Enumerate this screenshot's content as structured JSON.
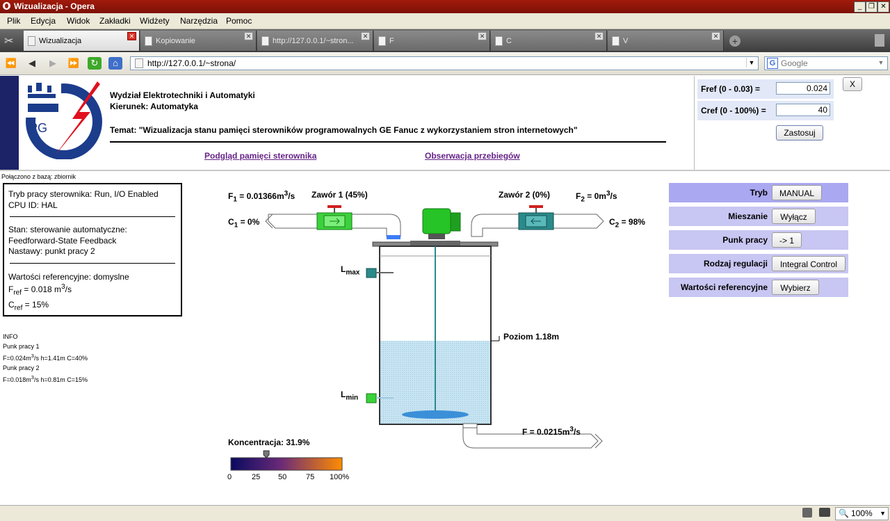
{
  "window": {
    "title": "Wizualizacja - Opera"
  },
  "menu": [
    "Plik",
    "Edycja",
    "Widok",
    "Zakładki",
    "Widżety",
    "Narzędzia",
    "Pomoc"
  ],
  "tabs": [
    {
      "label": "Wizualizacja"
    },
    {
      "label": "Kopiowanie"
    },
    {
      "label": "http://127.0.0.1/~stron..."
    },
    {
      "label": "F"
    },
    {
      "label": "C"
    },
    {
      "label": "V"
    }
  ],
  "address": {
    "url": "http://127.0.0.1/~strona/",
    "search_placeholder": "Google"
  },
  "header": {
    "line1": "Wydział Elektrotechniki i Automatyki",
    "line2": "Kierunek: Automatyka",
    "topic": "Temat: \"Wizualizacja stanu pamięci sterowników programowalnych GE Fanuc z wykorzystaniem stron internetowych\"",
    "link1": "Podgląd pamięci sterownika",
    "link2": "Obserwacja przebiegów",
    "logo_text": "PG"
  },
  "refs": {
    "fref_label": "Fref (0 - 0.03) =",
    "fref_value": "0.024",
    "cref_label": "Cref (0 - 100%) =",
    "cref_value": "40",
    "apply_label": "Zastosuj",
    "close_label": "X"
  },
  "connected": "Połączono z bazą: zbiornik",
  "status": {
    "mode": "Tryb pracy sterownika: Run, I/O Enabled",
    "cpu": "CPU ID: HAL",
    "state": "Stan: sterowanie automatyczne:",
    "ff": "Feedforward-State Feedback",
    "settings": "Nastawy: punkt pracy 2",
    "refvals": "Wartości referencyjne: domyslne",
    "fref_text": "F",
    "fref_sub": "ref",
    "fref_val": " = 0.018 m",
    "fref_unit_sup": "3",
    "fref_unit_tail": "/s",
    "cref_text": "C",
    "cref_sub": "ref",
    "cref_val": " = 15%"
  },
  "info": {
    "title": "INFO",
    "p1_title": "Punk pracy 1",
    "p1_a": "F=0.024m",
    "p1_sup": "3",
    "p1_b": "/s h=1.41m C=40%",
    "p2_title": "Punk pracy 2",
    "p2_a": "F=0.018m",
    "p2_sup": "3",
    "p2_b": "/s h=0.81m C=15%"
  },
  "process": {
    "f1_a": "F",
    "f1_sub": "1",
    "f1_b": " = 0.01366m",
    "f1_sup": "3",
    "f1_c": "/s",
    "valve1": "Zawór 1 (45%)",
    "valve2": "Zawór 2 (0%)",
    "f2_a": "F",
    "f2_sub": "2",
    "f2_b": " = 0m",
    "f2_sup": "3",
    "f2_c": "/s",
    "c1_a": "C",
    "c1_sub": "1",
    "c1_b": " = 0%",
    "c2_a": "C",
    "c2_sub": "2",
    "c2_b": " = 98%",
    "lmax_a": "L",
    "lmax_sub": "max",
    "lmin_a": "L",
    "lmin_sub": "min",
    "level": "Poziom 1.18m",
    "fout_a": "F = 0.0215m",
    "fout_sup": "3",
    "fout_b": "/s",
    "conc": "Koncentracja: 31.9%",
    "conc_value": 31.9,
    "scale": [
      "0",
      "25",
      "50",
      "75",
      "100%"
    ]
  },
  "controls": [
    {
      "label": "Tryb",
      "button": "MANUAL"
    },
    {
      "label": "Mieszanie",
      "button": "Wyłącz"
    },
    {
      "label": "Punk pracy",
      "button": "-> 1"
    },
    {
      "label": "Rodzaj regulacji",
      "button": "Integral Control"
    },
    {
      "label": "Wartości referencyjne",
      "button": "Wybierz"
    }
  ],
  "zoom": "100%",
  "colors": {
    "titlebar": "#a11b0c",
    "link": "#662288",
    "control_bg": "#c8c6f2",
    "tryb_bg": "#aaa8f0",
    "valve1": "#3ad23a",
    "valve2": "#2a8a8a",
    "water": "#c7e4f2"
  }
}
